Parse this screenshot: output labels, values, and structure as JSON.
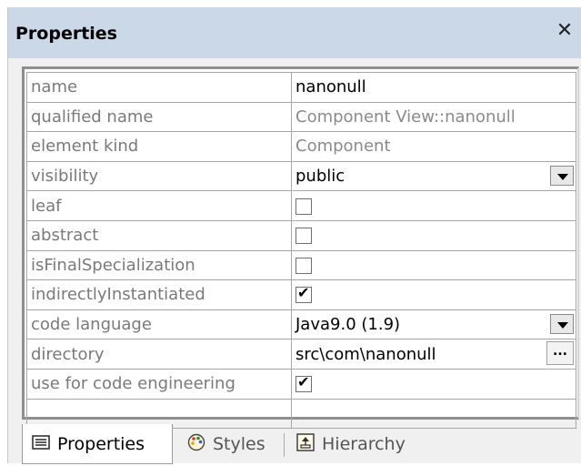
{
  "panel": {
    "title": "Properties",
    "close_glyph": "✕"
  },
  "rows": [
    {
      "key": "name",
      "value": "nanonull",
      "type": "text"
    },
    {
      "key": "qualified name",
      "value": "Component View::nanonull",
      "type": "readonly"
    },
    {
      "key": "element kind",
      "value": "Component",
      "type": "readonly"
    },
    {
      "key": "visibility",
      "value": "public",
      "type": "dropdown"
    },
    {
      "key": "leaf",
      "checked": false,
      "type": "checkbox"
    },
    {
      "key": "abstract",
      "checked": false,
      "type": "checkbox"
    },
    {
      "key": "isFinalSpecialization",
      "checked": false,
      "type": "checkbox"
    },
    {
      "key": "indirectlyInstantiated",
      "checked": true,
      "type": "checkbox"
    },
    {
      "key": "code language",
      "value": "Java9.0 (1.9)",
      "type": "dropdown"
    },
    {
      "key": "directory",
      "value": "src\\com\\nanonull",
      "type": "ellipsis",
      "button_label": "..."
    },
    {
      "key": "use for code engineering",
      "checked": true,
      "type": "checkbox"
    },
    {
      "key": "",
      "value": "",
      "type": "empty"
    }
  ],
  "tabs": [
    {
      "label": "Properties",
      "icon": "properties-icon",
      "active": true
    },
    {
      "label": "Styles",
      "icon": "palette-icon",
      "active": false
    },
    {
      "label": "Hierarchy",
      "icon": "hierarchy-icon",
      "active": false
    }
  ]
}
